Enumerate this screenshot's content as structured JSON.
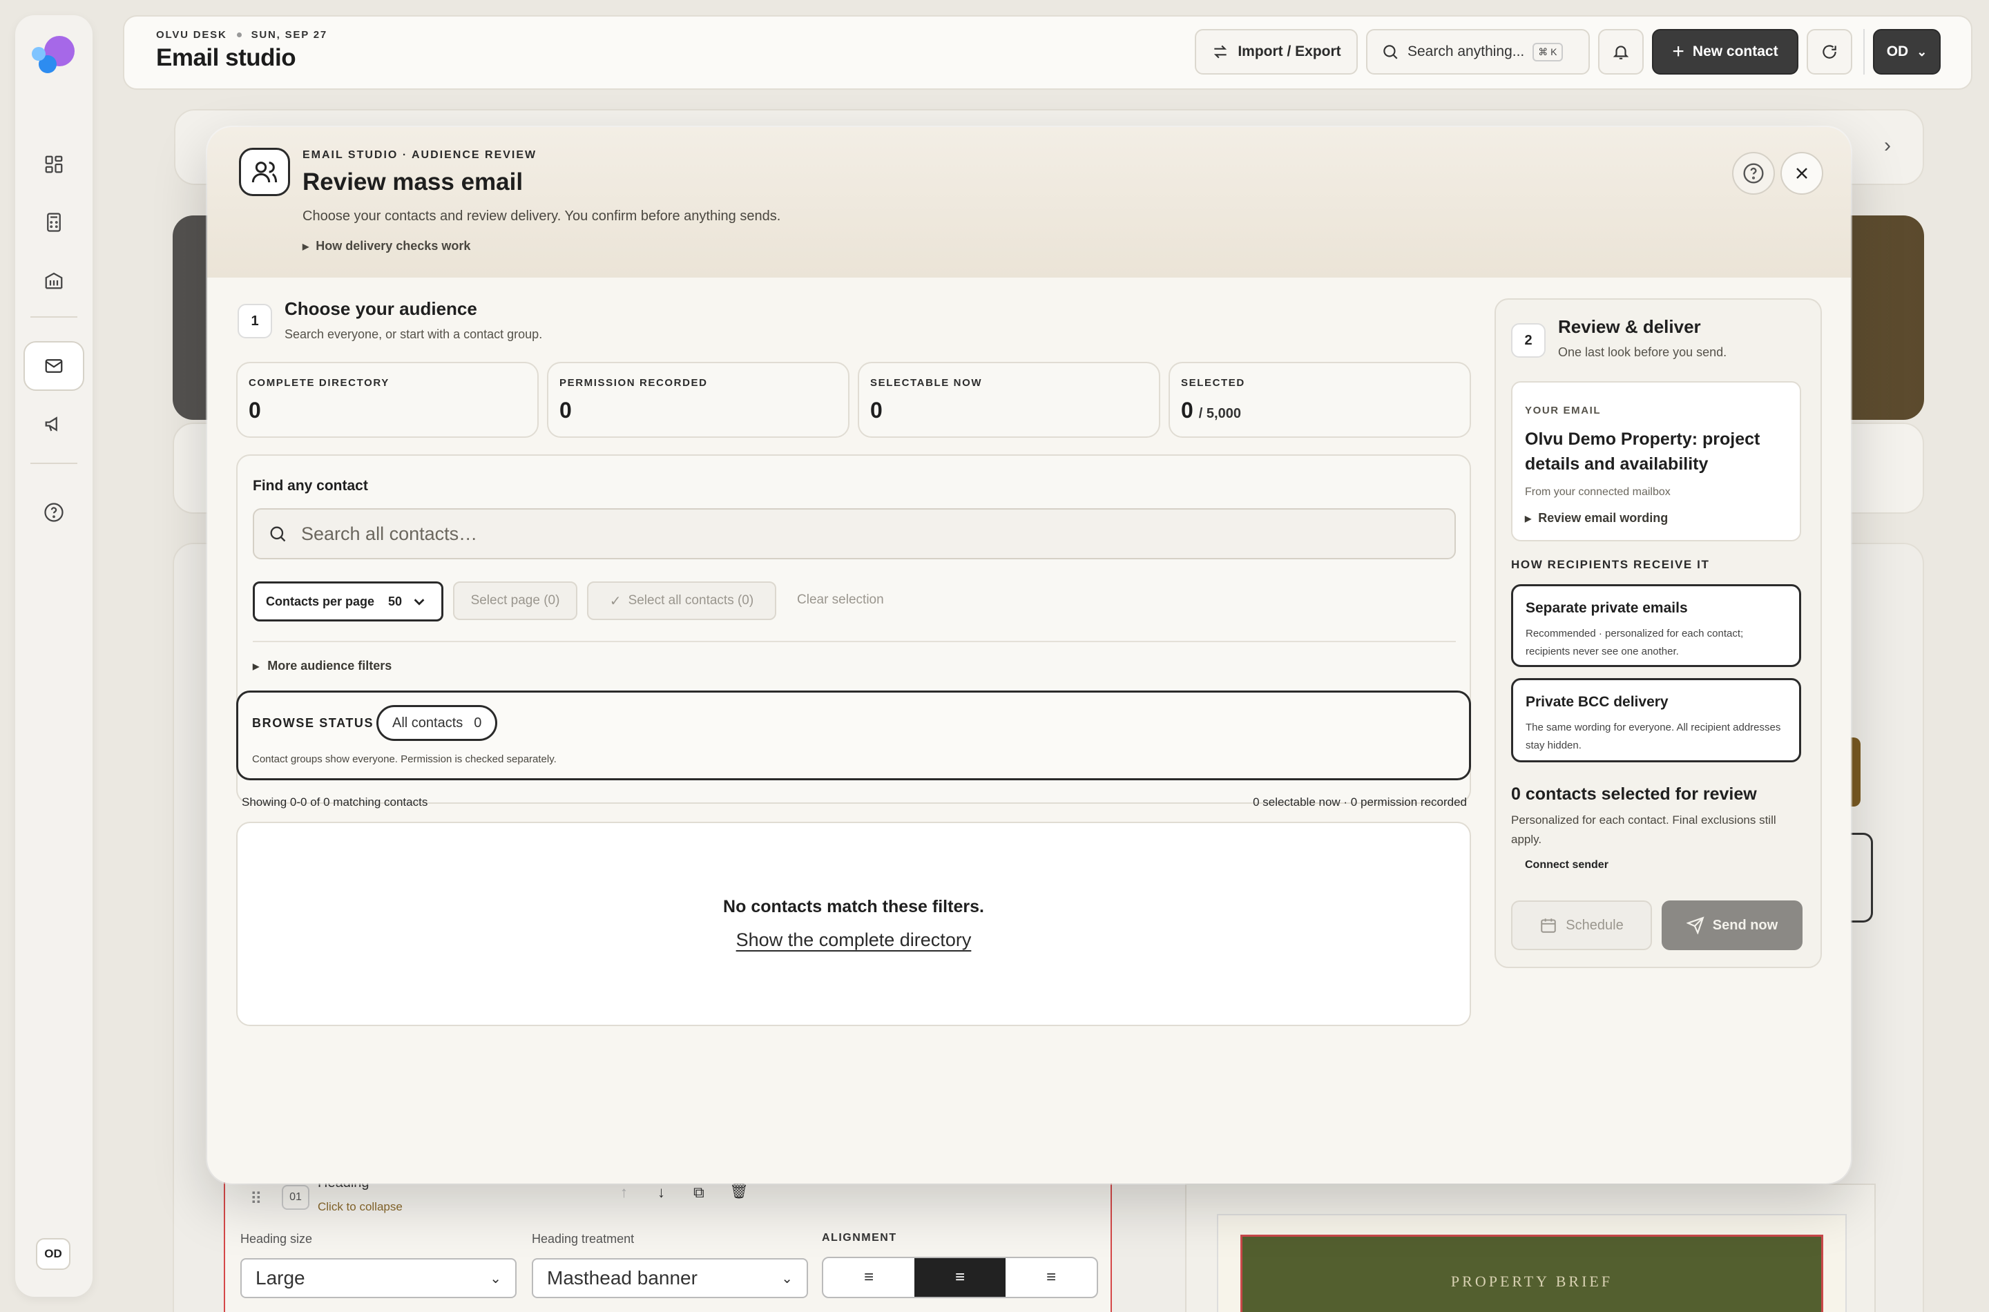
{
  "sidebar": {
    "icons": [
      "dashboard-icon",
      "calculator-icon",
      "building-icon",
      "mail-icon",
      "megaphone-icon",
      "help-icon"
    ],
    "avatar": "OD"
  },
  "header": {
    "workspace": "OLVU DESK",
    "date": "SUN, SEP 27",
    "title": "Email studio",
    "import_export": "Import / Export",
    "search_placeholder": "Search anything...",
    "shortcut": "⌘ K",
    "new_contact": "New contact",
    "user_menu": "OD"
  },
  "modal": {
    "eyebrow": "EMAIL STUDIO · AUDIENCE REVIEW",
    "title": "Review mass email",
    "subtitle": "Choose your contacts and review delivery. You confirm before anything sends.",
    "how_checks": "How delivery checks work",
    "step1": {
      "number": "1",
      "title": "Choose your audience",
      "subtitle": "Search everyone, or start with a contact group."
    },
    "stats": [
      {
        "label": "COMPLETE DIRECTORY",
        "value": "0",
        "suffix": ""
      },
      {
        "label": "PERMISSION RECORDED",
        "value": "0",
        "suffix": ""
      },
      {
        "label": "SELECTABLE NOW",
        "value": "0",
        "suffix": ""
      },
      {
        "label": "SELECTED",
        "value": "0",
        "suffix": "/ 5,000"
      }
    ],
    "find": {
      "title": "Find any contact",
      "placeholder": "Search all contacts…",
      "per_page_label": "Contacts per page",
      "per_page_value": "50",
      "select_page": "Select page (0)",
      "select_all": "Select all contacts (0)",
      "clear_selection": "Clear selection",
      "more_filters": "More audience filters"
    },
    "browse": {
      "label": "BROWSE STATUS",
      "chip_label": "All contacts",
      "chip_count": "0",
      "note": "Contact groups show everyone. Permission is checked separately."
    },
    "results": {
      "showing": "Showing 0-0 of 0 matching contacts",
      "summary": "0 selectable now · 0 permission recorded",
      "empty_title": "No contacts match these filters.",
      "empty_link": "Show the complete directory"
    },
    "step2": {
      "number": "2",
      "title": "Review & deliver",
      "subtitle": "One last look before you send.",
      "email_eyebrow": "YOUR EMAIL",
      "email_subject": "Olvu Demo Property: project details and availability",
      "email_source": "From your connected mailbox",
      "review_wording": "Review email wording",
      "receive_heading": "HOW RECIPIENTS RECEIVE IT",
      "options": [
        {
          "title": "Separate private emails",
          "desc": "Recommended · personalized for each contact; recipients never see one another."
        },
        {
          "title": "Private BCC delivery",
          "desc": "The same wording for everyone. All recipient addresses stay hidden."
        }
      ],
      "selected_title": "0 contacts selected for review",
      "selected_desc": "Personalized for each contact. Final exclusions still apply.",
      "connect_sender": "Connect sender",
      "schedule": "Schedule",
      "send_now": "Send now"
    }
  },
  "editor": {
    "block_number": "01",
    "block_title": "Heading",
    "block_hint": "Click to collapse",
    "heading_size_label": "Heading size",
    "heading_size_value": "Large",
    "treatment_label": "Heading treatment",
    "treatment_value": "Masthead banner",
    "alignment_label": "ALIGNMENT",
    "preview_banner": "PROPERTY BRIEF"
  },
  "colors": {
    "accent_dark": "#3b3b3b",
    "preview_green": "#535f2f",
    "preview_border": "#c9484a"
  }
}
